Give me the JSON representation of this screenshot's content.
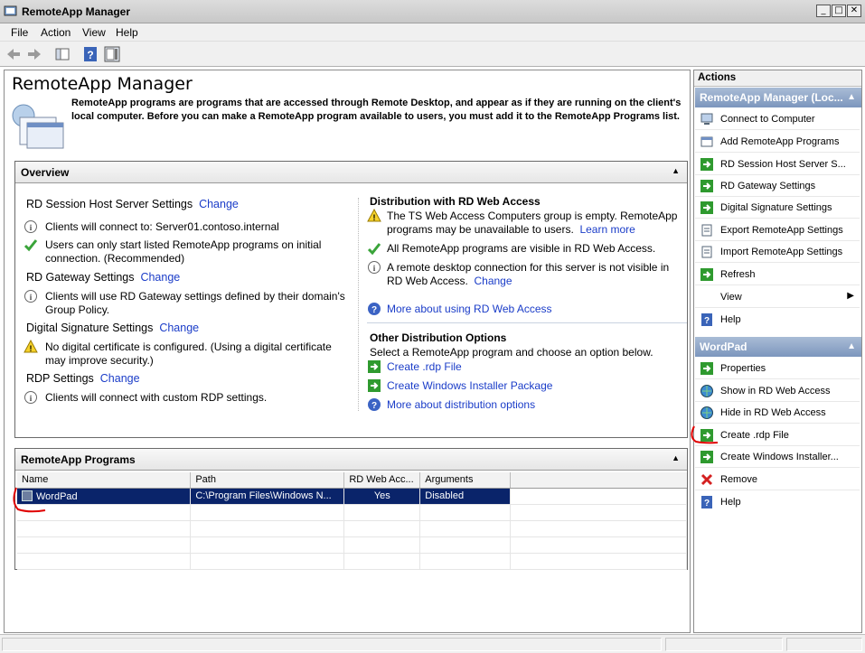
{
  "window": {
    "title": "RemoteApp Manager"
  },
  "menu": [
    "File",
    "Action",
    "View",
    "Help"
  ],
  "main": {
    "title": "RemoteApp Manager",
    "intro": "RemoteApp programs are programs that are accessed through Remote Desktop, and appear as if they are running on the client's local computer. Before you can make a RemoteApp program available to users, you must add it to the RemoteApp Programs list."
  },
  "overview": {
    "header": "Overview",
    "rdsh": {
      "title": "RD Session Host Server Settings",
      "change": "Change",
      "items": [
        "Clients will connect to: Server01.contoso.internal",
        "Users can only start listed RemoteApp programs on initial connection. (Recommended)"
      ]
    },
    "gateway": {
      "title": "RD Gateway Settings",
      "change": "Change",
      "items": [
        "Clients will use RD Gateway settings defined by their domain's Group Policy."
      ]
    },
    "signature": {
      "title": "Digital Signature Settings",
      "change": "Change",
      "items": [
        "No digital certificate is configured. (Using a digital certificate may improve security.)"
      ]
    },
    "rdp": {
      "title": "RDP Settings",
      "change": "Change",
      "items": [
        "Clients will connect with custom RDP settings."
      ]
    },
    "webaccess": {
      "title": "Distribution with RD Web Access",
      "warn": "The TS Web Access Computers group is empty. RemoteApp programs may be unavailable to users.",
      "learn_more": "Learn more",
      "visible": "All RemoteApp programs are visible in RD Web Access.",
      "notvisible": "A remote desktop connection for this server is not visible in RD Web Access.",
      "change": "Change",
      "more": "More about using RD Web Access"
    },
    "other": {
      "title": "Other Distribution Options",
      "desc": "Select a RemoteApp program and choose an option below.",
      "create_rdp": "Create .rdp File",
      "create_msi": "Create Windows Installer Package",
      "more": "More about distribution options"
    }
  },
  "programs": {
    "header": "RemoteApp Programs",
    "columns": [
      "Name",
      "Path",
      "RD Web Acc...",
      "Arguments"
    ],
    "rows": [
      {
        "name": "WordPad",
        "path": "C:\\Program Files\\Windows N...",
        "web": "Yes",
        "args": "Disabled"
      }
    ]
  },
  "actions": {
    "header": "Actions",
    "group1": "RemoteApp Manager (Loc...",
    "items1": [
      "Connect to Computer",
      "Add RemoteApp Programs",
      "RD Session Host Server S...",
      "RD Gateway Settings",
      "Digital Signature Settings",
      "Export RemoteApp Settings",
      "Import RemoteApp Settings",
      "Refresh",
      "View",
      "Help"
    ],
    "group2": "WordPad",
    "items2": [
      "Properties",
      "Show in RD Web Access",
      "Hide in RD Web Access",
      "Create .rdp File",
      "Create Windows Installer...",
      "Remove",
      "Help"
    ]
  },
  "colors": {
    "link": "#1a3cc8",
    "selection": "#0a246a",
    "action_header": "#7c96bd",
    "annotation": "#e00000"
  }
}
